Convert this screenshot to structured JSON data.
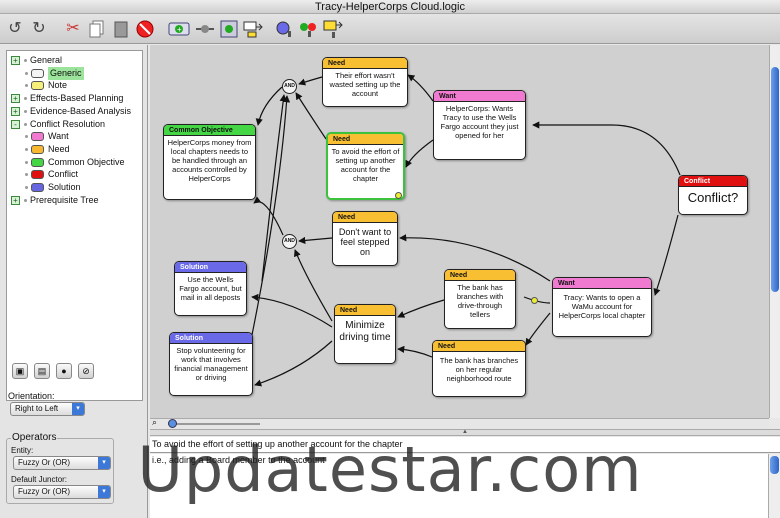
{
  "window": {
    "title": "Tracy-HelperCorps Cloud.logic"
  },
  "toolbar": {
    "icons": [
      "undo-icon",
      "redo-icon",
      "cut-icon",
      "copy-icon",
      "paste-icon",
      "delete-icon",
      "add-entity-icon",
      "add-junctor-icon",
      "add-child-icon",
      "insert-icon",
      "entity-color-icon",
      "zoom-icon",
      "layout-icon"
    ]
  },
  "sidebar": {
    "tree": [
      {
        "label": "General",
        "toggle": "+",
        "level": 0
      },
      {
        "label": "Generic",
        "swatch": "#f4f4f4",
        "level": 1,
        "selected": true
      },
      {
        "label": "Note",
        "swatch": "#f6f07a",
        "level": 1
      },
      {
        "label": "Effects-Based Planning",
        "toggle": "+",
        "level": 0
      },
      {
        "label": "Evidence-Based Analysis",
        "toggle": "+",
        "level": 0
      },
      {
        "label": "Conflict Resolution",
        "toggle": "-",
        "level": 0
      },
      {
        "label": "Want",
        "swatch": "#f07ad0",
        "level": 1
      },
      {
        "label": "Need",
        "swatch": "#f8b830",
        "level": 1
      },
      {
        "label": "Common Objective",
        "swatch": "#44d644",
        "level": 1
      },
      {
        "label": "Conflict",
        "swatch": "#e01010",
        "level": 1
      },
      {
        "label": "Solution",
        "swatch": "#6666e0",
        "level": 1
      },
      {
        "label": "Prerequisite Tree",
        "toggle": "+",
        "level": 0
      }
    ],
    "orientation_label": "Orientation:",
    "orientation_value": "Right to Left",
    "operators_label": "Operators",
    "entity_label": "Entity:",
    "entity_value": "Fuzzy Or (OR)",
    "junctor_label": "Default Junctor:",
    "junctor_value": "Fuzzy Or (OR)"
  },
  "diagram": {
    "nodes": [
      {
        "id": "need1",
        "type": "Need",
        "text": "Their effort wasn't wasted setting up the account"
      },
      {
        "id": "want1",
        "type": "Want",
        "text": "HelperCorps: Wants Tracy to use the Wells Fargo account they just opened for her"
      },
      {
        "id": "co",
        "type": "Common Objective",
        "text": "HelperCorps money from local chapters needs to be handled through an accounts controlled by HelperCorps"
      },
      {
        "id": "need2",
        "type": "Need",
        "text": "To avoid the effort of setting up another account for the chapter"
      },
      {
        "id": "conflict",
        "type": "Conflict",
        "text": "Conflict?"
      },
      {
        "id": "need3",
        "type": "Need",
        "text": "Don't want to feel stepped on"
      },
      {
        "id": "sol1",
        "type": "Solution",
        "text": "Use the Wells Fargo account, but mail in all deposts"
      },
      {
        "id": "need4",
        "type": "Need",
        "text": "The bank has branches with drive-through tellers"
      },
      {
        "id": "want2",
        "type": "Want",
        "text": "Tracy: Wants to open a WaMu account for HelperCorps local chapter"
      },
      {
        "id": "need5",
        "type": "Need",
        "text": "Minimize driving time"
      },
      {
        "id": "sol2",
        "type": "Solution",
        "text": "Stop volunteering for work that involves financial management or driving"
      },
      {
        "id": "need6",
        "type": "Need",
        "text": "The bank has branches on her regular neighborhood route"
      }
    ],
    "and_label": "AND",
    "colors": {
      "Need": "#f8bf32",
      "Want": "#f07ad0",
      "Common Objective": "#44d644",
      "Conflict": "#e01010",
      "Solution": "#6a6ae8"
    }
  },
  "details": {
    "title_text": "To avoid the effort of setting up another account for the chapter",
    "note_text": "i.e., adding a Board member to the account"
  },
  "watermark": "Updatestar.com"
}
